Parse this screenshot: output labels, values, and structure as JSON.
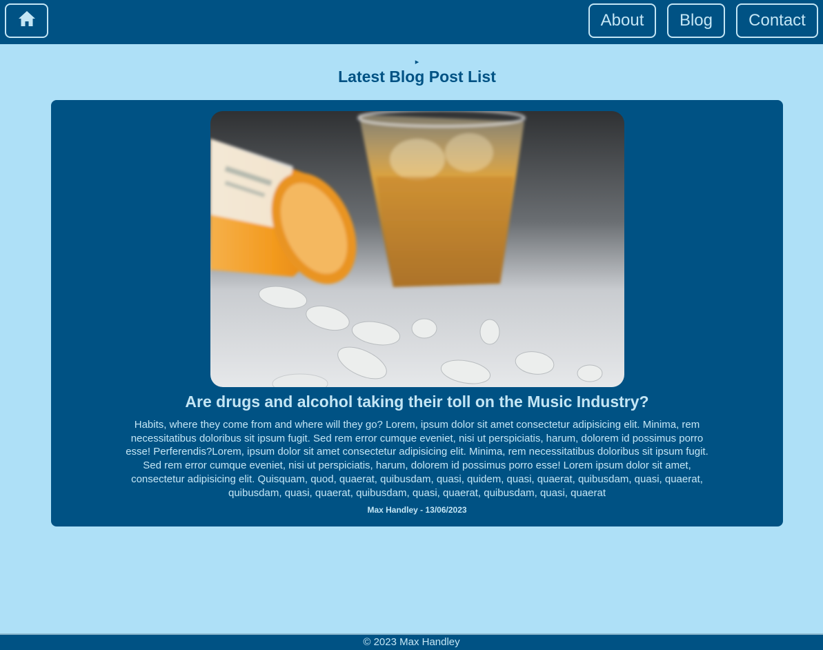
{
  "nav": {
    "home_icon": "home-icon",
    "about_label": "About",
    "blog_label": "Blog",
    "contact_label": "Contact"
  },
  "main": {
    "toggle_arrow": "▸",
    "section_title": "Latest Blog Post List",
    "post": {
      "image_description": "prescription-pill-bottle-and-whiskey-glass",
      "title": "Are drugs and alcohol taking their toll on the Music Industry?",
      "body": "Habits, where they come from and where will they go? Lorem, ipsum dolor sit amet consectetur adipisicing elit. Minima, rem necessitatibus doloribus sit ipsum fugit. Sed rem error cumque eveniet, nisi ut perspiciatis, harum, dolorem id possimus porro esse! Perferendis?Lorem, ipsum dolor sit amet consectetur adipisicing elit. Minima, rem necessitatibus doloribus sit ipsum fugit. Sed rem error cumque eveniet, nisi ut perspiciatis, harum, dolorem id possimus porro esse! Lorem ipsum dolor sit amet, consectetur adipisicing elit. Quisquam, quod, quaerat, quibusdam, quasi, quidem, quasi, quaerat, quibusdam, quasi, quaerat, quibusdam, quasi, quaerat, quibusdam, quasi, quaerat, quibusdam, quasi, quaerat",
      "meta": "Max Handley - 13/06/2023"
    }
  },
  "footer": {
    "text": "© 2023 Max Handley"
  },
  "colors": {
    "primary": "#005284",
    "background": "#aee0f7",
    "text_light": "#c4e6f5"
  }
}
